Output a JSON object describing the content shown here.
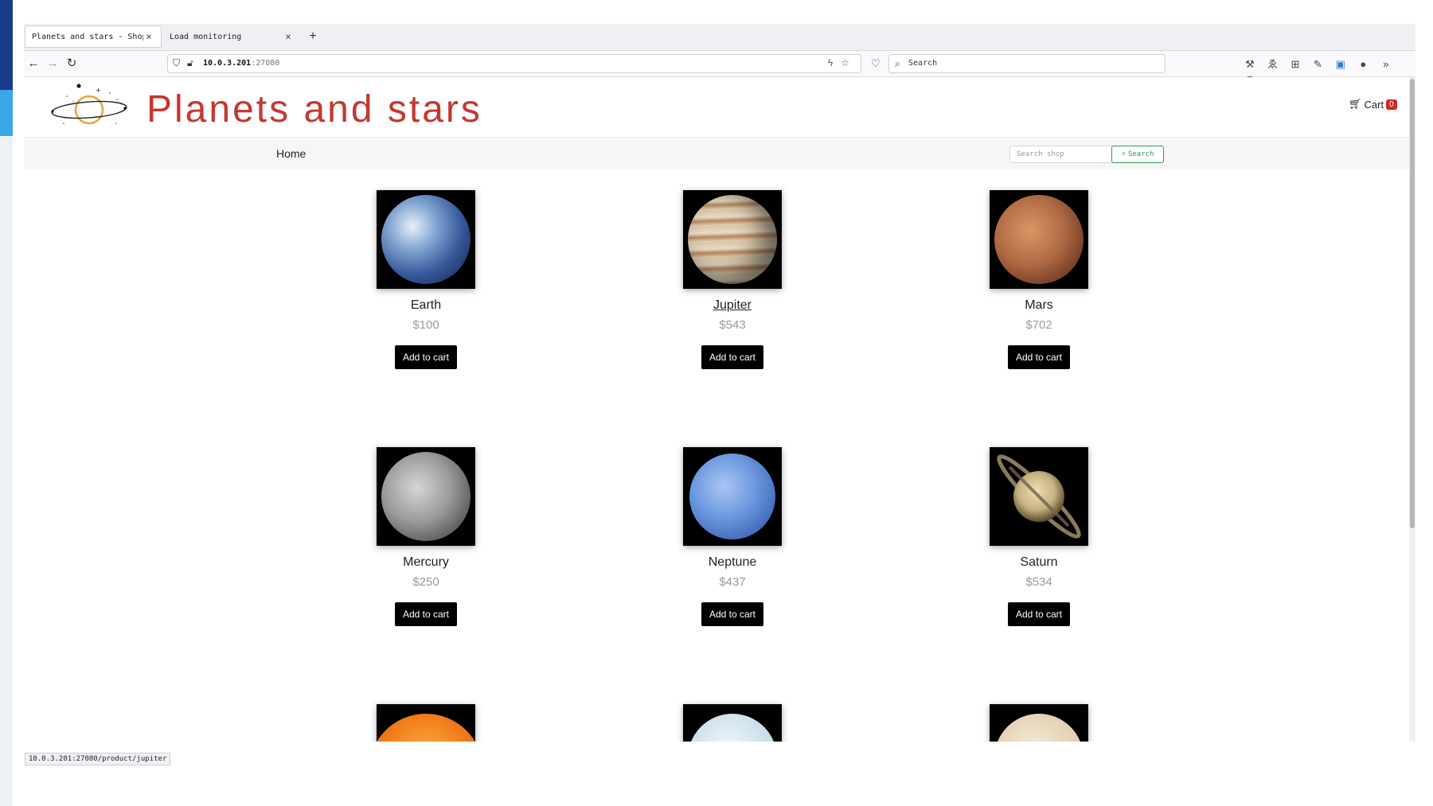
{
  "browser": {
    "tabs": [
      {
        "title": "Planets and stars - Shop",
        "close": "×",
        "active": true
      },
      {
        "title": "Load monitoring",
        "close": "×",
        "active": false
      }
    ],
    "new_tab": "+",
    "url_host": "10.0.3.201",
    "url_port": ":27080",
    "search_placeholder": "Search",
    "status_url": "10.0.3.201:27080/product/jupiter"
  },
  "site": {
    "title": "Planets and stars",
    "cart_label": "Cart",
    "cart_count": "0",
    "nav_home": "Home",
    "search_placeholder": "Search shop",
    "search_button": "Search"
  },
  "products": [
    {
      "name": "Earth",
      "price": "$100",
      "button": "Add to cart",
      "color": "#4a78b8"
    },
    {
      "name": "Jupiter",
      "price": "$543",
      "button": "Add to cart",
      "color": "#c9b08c"
    },
    {
      "name": "Mars",
      "price": "$702",
      "button": "Add to cart",
      "color": "#b06a44"
    },
    {
      "name": "Mercury",
      "price": "$250",
      "button": "Add to cart",
      "color": "#8f8f8f"
    },
    {
      "name": "Neptune",
      "price": "$437",
      "button": "Add to cart",
      "color": "#5f8fd6"
    },
    {
      "name": "Saturn",
      "price": "$534",
      "button": "Add to cart",
      "color": "#c7b181"
    }
  ],
  "colors": {
    "title": "#c4372f",
    "search_accent": "#2e9e4a",
    "badge": "#d9251d"
  }
}
